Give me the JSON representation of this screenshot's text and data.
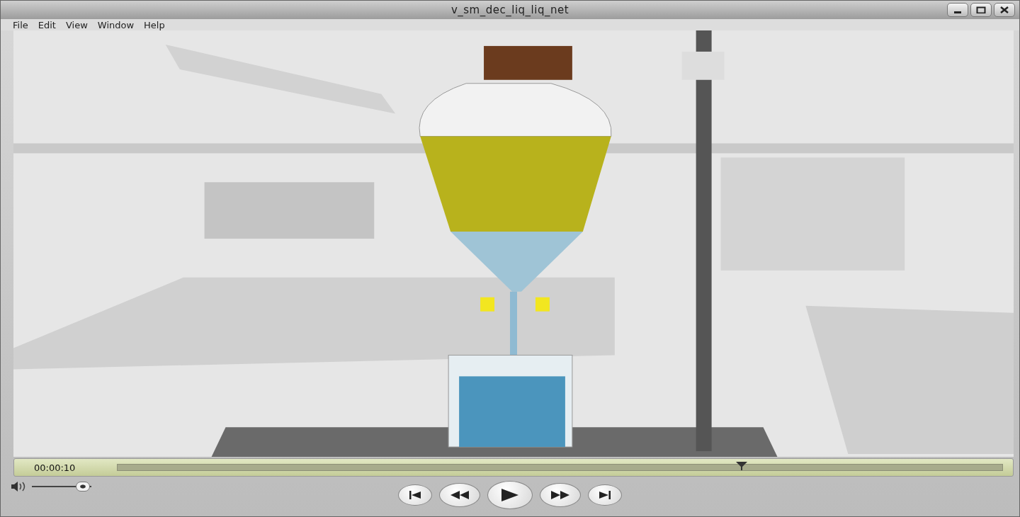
{
  "window": {
    "title": "v_sm_dec_liq_liq_net"
  },
  "menu": [
    "File",
    "Edit",
    "View",
    "Window",
    "Help"
  ],
  "timeline": {
    "time": "00:00:10",
    "level": 0.705
  },
  "volume": {
    "level": 0.97
  }
}
